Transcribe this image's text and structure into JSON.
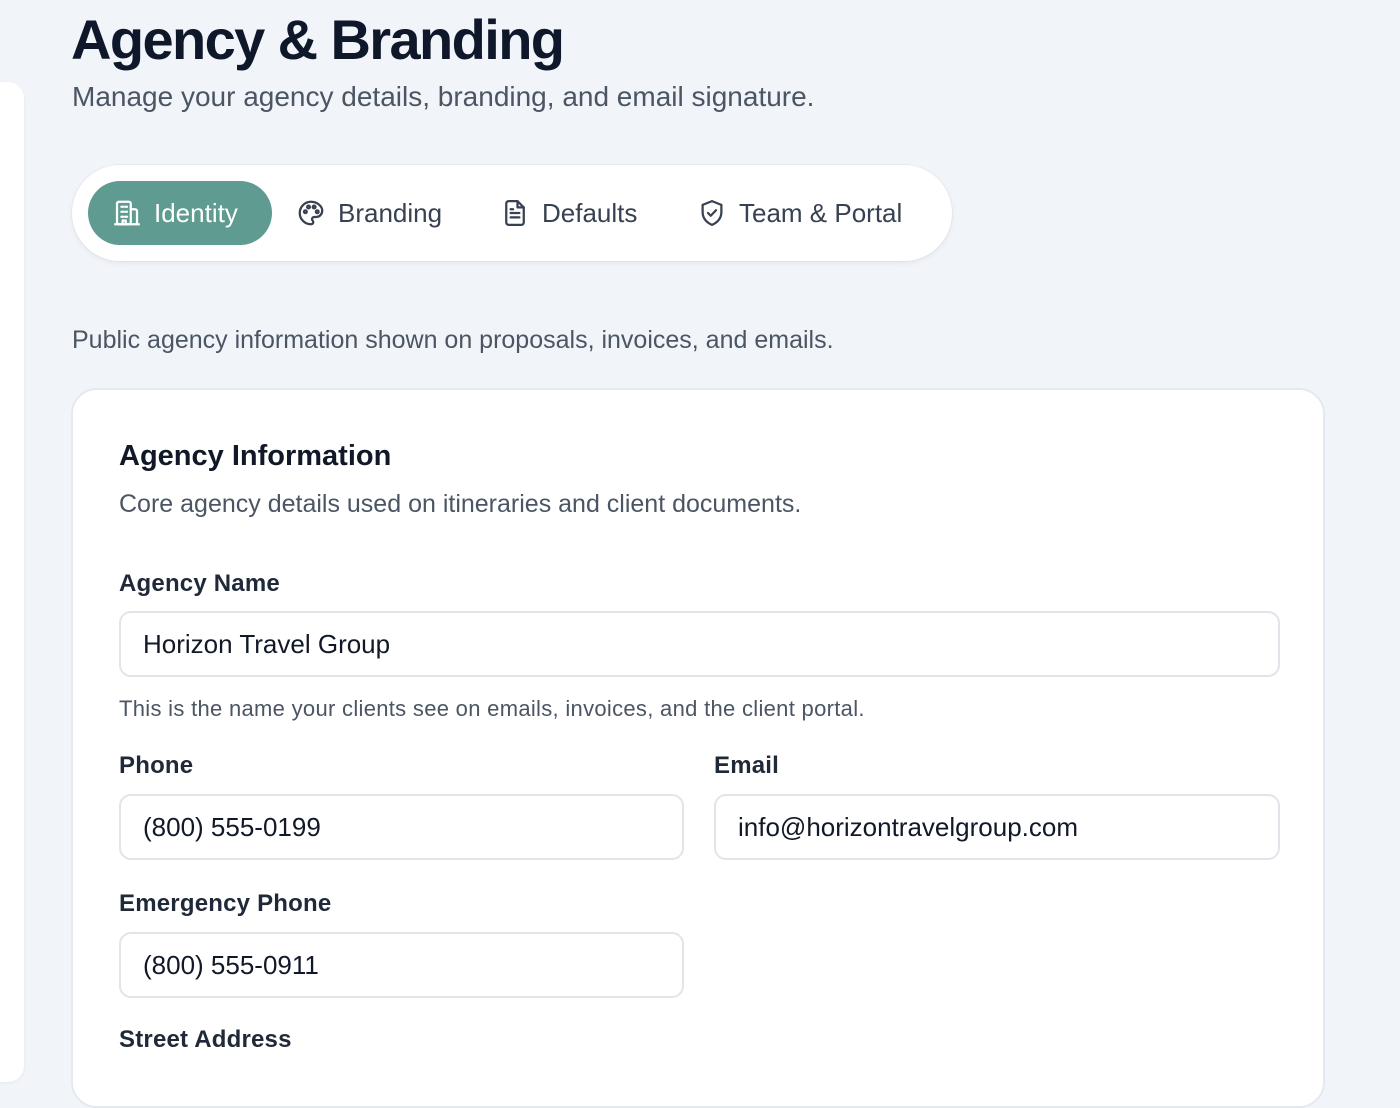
{
  "header": {
    "title": "Agency & Branding",
    "subtitle": "Manage your agency details, branding, and email signature."
  },
  "tabs": [
    {
      "label": "Identity",
      "icon": "building-icon",
      "active": true
    },
    {
      "label": "Branding",
      "icon": "palette-icon",
      "active": false
    },
    {
      "label": "Defaults",
      "icon": "document-icon",
      "active": false
    },
    {
      "label": "Team & Portal",
      "icon": "shield-check-icon",
      "active": false
    }
  ],
  "section": {
    "description": "Public agency information shown on proposals, invoices, and emails."
  },
  "card": {
    "title": "Agency Information",
    "description": "Core agency details used on itineraries and client documents.",
    "fields": {
      "agency_name": {
        "label": "Agency Name",
        "value": "Horizon Travel Group",
        "help": "This is the name your clients see on emails, invoices, and the client portal."
      },
      "phone": {
        "label": "Phone",
        "value": "(800) 555-0199"
      },
      "email": {
        "label": "Email",
        "value": "info@horizontravelgroup.com"
      },
      "emergency_phone": {
        "label": "Emergency Phone",
        "value": "(800) 555-0911"
      },
      "street_address": {
        "label": "Street Address"
      }
    }
  },
  "colors": {
    "accent": "#5f9b91",
    "background": "#f1f4f9",
    "card": "#ffffff"
  }
}
